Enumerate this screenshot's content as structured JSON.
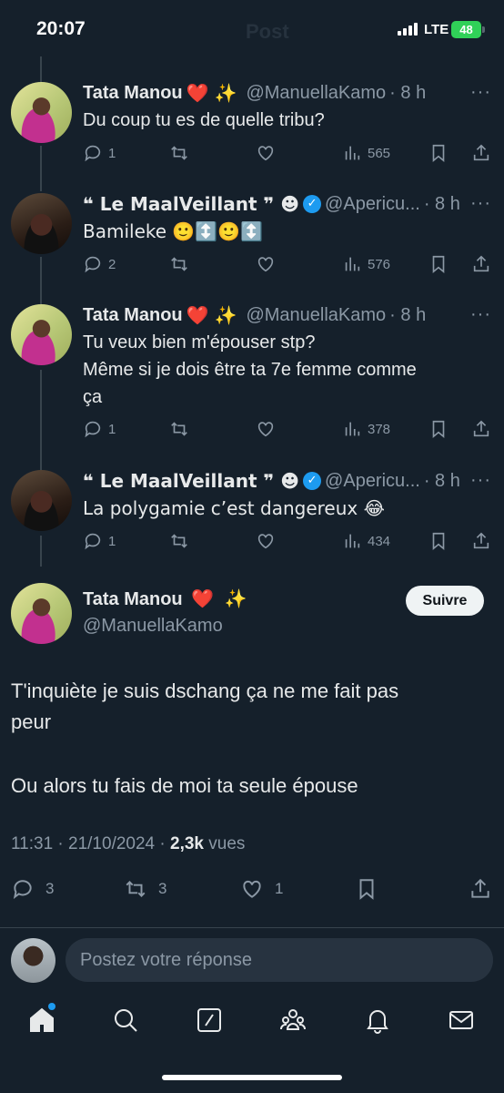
{
  "status_bar": {
    "time": "20:07",
    "network": "LTE",
    "battery": "48",
    "header_behind": "Post"
  },
  "thread": [
    {
      "author": "Tata Manou",
      "author_emoji_heart": "❤️",
      "author_emoji_spark": "✨",
      "handle": "@ManuellaKamo",
      "age": "· 8 h",
      "text_lines": [
        "Du coup tu es de quelle tribu?"
      ],
      "replies": "1",
      "views": "565"
    },
    {
      "author": "❝ Le MaalVeillant ❞ ☻",
      "verified": true,
      "handle": "@Apericu...",
      "age": "· 8 h",
      "text_lines": [
        "Bamileke 🙂↕️🙂↕️"
      ],
      "replies": "2",
      "views": "576"
    },
    {
      "author": "Tata Manou",
      "author_emoji_heart": "❤️",
      "author_emoji_spark": "✨",
      "handle": "@ManuellaKamo",
      "age": "· 8 h",
      "text_lines": [
        "Tu veux bien m'épouser stp?",
        "Même si je dois être ta 7e femme comme",
        "ça"
      ],
      "replies": "1",
      "views": "378"
    },
    {
      "author": "❝ Le MaalVeillant ❞ ☻",
      "verified": true,
      "handle": "@Apericu...",
      "age": "· 8 h",
      "text_lines": [
        "La polygamie c’est dangereux 😂"
      ],
      "replies": "1",
      "views": "434"
    }
  ],
  "main_tweet": {
    "author": "Tata Manou",
    "author_emoji_heart": "❤️",
    "author_emoji_spark": "✨",
    "handle": "@ManuellaKamo",
    "follow_label": "Suivre",
    "paragraph_1_line_1": "T'inquiète je suis dschang ça ne me fait pas",
    "paragraph_1_line_2": "peur",
    "paragraph_2": "Ou alors tu fais de moi ta seule épouse",
    "timestamp": "11:31 · 21/10/2024 ·",
    "views_count": "2,3k",
    "views_label": "vues",
    "replies": "3",
    "reposts": "3",
    "likes": "1"
  },
  "reply_bar": {
    "placeholder": "Postez votre réponse"
  },
  "icons": {
    "reply": "reply-icon",
    "retweet": "retweet-icon",
    "like": "like-icon",
    "views": "views-icon",
    "bookmark": "bookmark-icon",
    "share": "share-icon",
    "nav": [
      "home-icon",
      "search-icon",
      "grok-icon",
      "communities-icon",
      "notifications-icon",
      "messages-icon"
    ]
  },
  "colors": {
    "background": "#15202b",
    "accent": "#1d9bf0",
    "muted": "#8b98a5",
    "text": "#e7e9ea"
  }
}
